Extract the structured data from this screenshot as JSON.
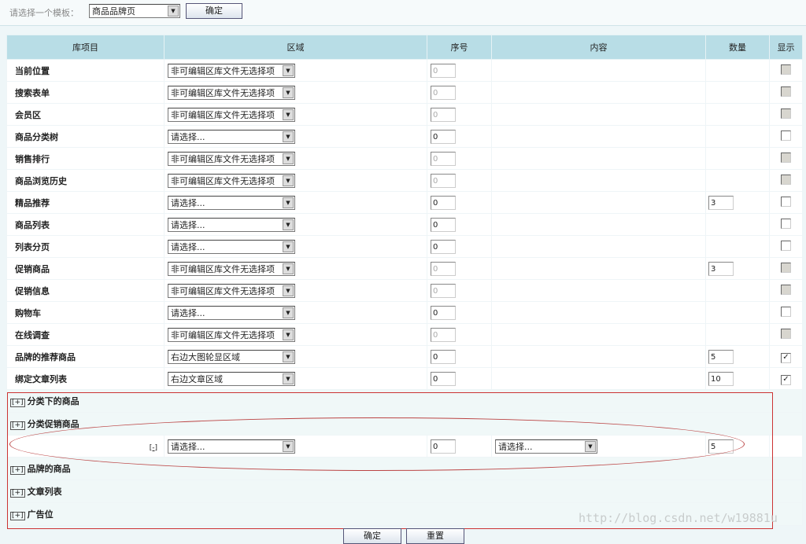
{
  "top": {
    "label": "请选择一个模板：",
    "template": "商品品牌页",
    "confirm": "确定"
  },
  "headers": [
    "库项目",
    "区域",
    "序号",
    "内容",
    "数量",
    "显示"
  ],
  "rows": [
    {
      "name": "当前位置",
      "region": "非可编辑区库文件无选择项",
      "seq": "0",
      "qty": "",
      "checked": false,
      "editable": false
    },
    {
      "name": "搜索表单",
      "region": "非可编辑区库文件无选择项",
      "seq": "0",
      "qty": "",
      "checked": false,
      "editable": false
    },
    {
      "name": "会员区",
      "region": "非可编辑区库文件无选择项",
      "seq": "0",
      "qty": "",
      "checked": false,
      "editable": false
    },
    {
      "name": "商品分类树",
      "region": "请选择...",
      "seq": "0",
      "qty": "",
      "checked": false,
      "editable": true
    },
    {
      "name": "销售排行",
      "region": "非可编辑区库文件无选择项",
      "seq": "0",
      "qty": "",
      "checked": false,
      "editable": false
    },
    {
      "name": "商品浏览历史",
      "region": "非可编辑区库文件无选择项",
      "seq": "0",
      "qty": "",
      "checked": false,
      "editable": false
    },
    {
      "name": "精品推荐",
      "region": "请选择...",
      "seq": "0",
      "qty": "3",
      "checked": false,
      "editable": true
    },
    {
      "name": "商品列表",
      "region": "请选择...",
      "seq": "0",
      "qty": "",
      "checked": false,
      "editable": true
    },
    {
      "name": "列表分页",
      "region": "请选择...",
      "seq": "0",
      "qty": "",
      "checked": false,
      "editable": true
    },
    {
      "name": "促销商品",
      "region": "非可编辑区库文件无选择项",
      "seq": "0",
      "qty": "3",
      "checked": false,
      "editable": false
    },
    {
      "name": "促销信息",
      "region": "非可编辑区库文件无选择项",
      "seq": "0",
      "qty": "",
      "checked": false,
      "editable": false
    },
    {
      "name": "购物车",
      "region": "请选择...",
      "seq": "0",
      "qty": "",
      "checked": false,
      "editable": true
    },
    {
      "name": "在线调查",
      "region": "非可编辑区库文件无选择项",
      "seq": "0",
      "qty": "",
      "checked": false,
      "editable": false
    },
    {
      "name": "品牌的推荐商品",
      "region": "右边大图轮显区域",
      "seq": "0",
      "qty": "5",
      "checked": true,
      "editable": true
    },
    {
      "name": "绑定文章列表",
      "region": "右边文章区域",
      "seq": "0",
      "qty": "10",
      "checked": true,
      "editable": true
    }
  ],
  "sections": [
    {
      "name": "分类下的商品",
      "toggle": "[+]"
    },
    {
      "name": "分类促销商品",
      "toggle": "[+]"
    },
    {
      "name": "品牌的商品",
      "toggle": "[+]"
    },
    {
      "name": "文章列表",
      "toggle": "[+]"
    },
    {
      "name": "广告位",
      "toggle": "[+]"
    }
  ],
  "expanded": {
    "toggle": "[-]",
    "region": "请选择...",
    "seq": "0",
    "content": "请选择...",
    "qty": "5"
  },
  "bottom": {
    "confirm": "确定",
    "reset": "重置"
  },
  "watermark": "http://blog.csdn.net/w19881u"
}
